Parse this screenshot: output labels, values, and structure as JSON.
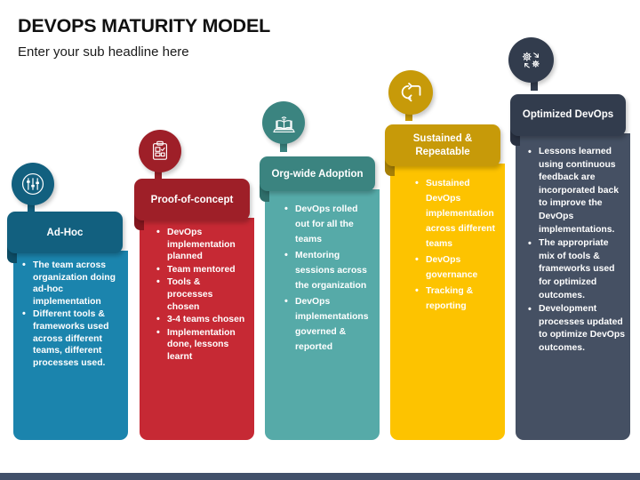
{
  "header": {
    "title": "DEVOPS MATURITY MODEL",
    "subtitle": "Enter your sub headline here"
  },
  "colors": {
    "stage1_body": "#1b84ad",
    "stage1_tab": "#12607f",
    "stage2_body": "#c62934",
    "stage2_tab": "#9e1f28",
    "stage3_body": "#56aaa8",
    "stage3_tab": "#3b8480",
    "stage4_body": "#fdc300",
    "stage4_tab": "#c79a09",
    "stage5_body": "#455063",
    "stage5_tab": "#323c4d",
    "bottom_bar": "#41506a",
    "title_text": "#111111",
    "bullet_text": "#ffffff"
  },
  "stages": [
    {
      "id": "ad-hoc",
      "label": "Ad-Hoc",
      "icon": "sliders-icon",
      "bullets": [
        "The team across organization doing ad-hoc implementation",
        "Different tools & frameworks used across different teams, different processes used."
      ]
    },
    {
      "id": "proof-of-concept",
      "label": "Proof-of-concept",
      "icon": "clipboard-check-icon",
      "bullets": [
        "DevOps implementation planned",
        "Team mentored",
        "Tools & processes chosen",
        "3-4 teams chosen",
        "Implementation done, lessons learnt"
      ]
    },
    {
      "id": "org-wide-adoption",
      "label": "Org-wide Adoption",
      "icon": "book-wifi-icon",
      "bullets": [
        "DevOps rolled out for all the teams",
        "Mentoring sessions across the organization",
        "DevOps implementations governed & reported"
      ]
    },
    {
      "id": "sustained-repeatable",
      "label": "Sustained & Repeatable",
      "icon": "repeat-arrows-icon",
      "bullets": [
        "Sustained DevOps implementation across different teams",
        "DevOps governance",
        "Tracking & reporting"
      ]
    },
    {
      "id": "optimized-devops",
      "label": "Optimized DevOps",
      "icon": "gears-cycle-icon",
      "bullets": [
        "Lessons learned using continuous feedback are incorporated back to improve the DevOps implementations.",
        "The appropriate mix of tools & frameworks used for optimized outcomes.",
        "Development processes updated to optimize DevOps outcomes."
      ]
    }
  ]
}
